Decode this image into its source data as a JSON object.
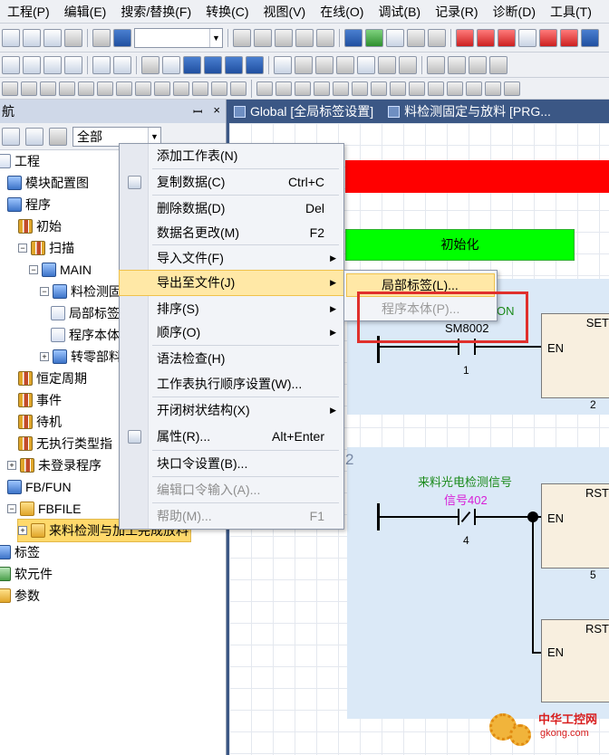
{
  "menubar": [
    "工程(P)",
    "编辑(E)",
    "搜索/替换(F)",
    "转换(C)",
    "视图(V)",
    "在线(O)",
    "调试(B)",
    "记录(R)",
    "诊断(D)",
    "工具(T)"
  ],
  "nav": {
    "title": "航",
    "pin": "ꟷ",
    "close": "×",
    "filter_value": "全部",
    "tree": [
      {
        "label": "工程",
        "indent": 0,
        "icon": "doc",
        "exp": ""
      },
      {
        "label": "模块配置图",
        "indent": 1,
        "icon": "prog",
        "exp": ""
      },
      {
        "label": "程序",
        "indent": 1,
        "icon": "prog",
        "exp": ""
      },
      {
        "label": "初始",
        "indent": 2,
        "icon": "bar",
        "exp": ""
      },
      {
        "label": "扫描",
        "indent": 2,
        "icon": "bar",
        "exp": "−"
      },
      {
        "label": "MAIN",
        "indent": 3,
        "icon": "prog",
        "exp": "−"
      },
      {
        "label": "料检测固定",
        "indent": 4,
        "icon": "prog",
        "exp": "−"
      },
      {
        "label": "局部标签",
        "indent": 5,
        "icon": "doc",
        "exp": ""
      },
      {
        "label": "程序本体",
        "indent": 5,
        "icon": "doc",
        "exp": ""
      },
      {
        "label": "转零部料",
        "indent": 4,
        "icon": "prog",
        "exp": "+"
      },
      {
        "label": "恒定周期",
        "indent": 2,
        "icon": "bar",
        "exp": ""
      },
      {
        "label": "事件",
        "indent": 2,
        "icon": "bar",
        "exp": ""
      },
      {
        "label": "待机",
        "indent": 2,
        "icon": "bar",
        "exp": ""
      },
      {
        "label": "无执行类型指",
        "indent": 2,
        "icon": "bar",
        "exp": ""
      },
      {
        "label": "未登录程序",
        "indent": 1,
        "icon": "bar",
        "exp": "+"
      },
      {
        "label": "FB/FUN",
        "indent": 1,
        "icon": "prog",
        "exp": ""
      },
      {
        "label": "FBFILE",
        "indent": 1,
        "icon": "folder",
        "exp": "−"
      },
      {
        "label": "来料检测与加工完成放料",
        "indent": 2,
        "icon": "folder",
        "exp": "+",
        "selected": true
      },
      {
        "label": "标签",
        "indent": 0,
        "icon": "prog",
        "exp": ""
      },
      {
        "label": "软元件",
        "indent": 0,
        "icon": "dev",
        "exp": ""
      },
      {
        "label": "参数",
        "indent": 0,
        "icon": "folder",
        "exp": ""
      }
    ]
  },
  "tabs": [
    {
      "label": "Global [全局标签设置]"
    },
    {
      "label": "料检测固定与放料 [PRG..."
    }
  ],
  "ladder": {
    "green_label": "初始化",
    "contact1_device": "SM8002",
    "contact1_step": "1",
    "coil1_label": "SET",
    "coil1_en": "EN",
    "coil1_step": "2",
    "partial_label": "ON",
    "section_mark": "2",
    "comment_line1": "来料光电检测信号",
    "comment_line2": "信号402",
    "contact2_step": "4",
    "coil2_label": "RST",
    "coil2_en": "EN",
    "coil2_step": "5",
    "coil3_label": "RST",
    "coil3_en": "EN"
  },
  "context_menu": [
    {
      "label": "添加工作表(N)",
      "shortcut": "",
      "submenu": false,
      "disabled": false
    },
    {
      "label": "复制数据(C)",
      "shortcut": "Ctrl+C",
      "submenu": false,
      "disabled": false,
      "icon": true
    },
    {
      "label": "删除数据(D)",
      "shortcut": "Del",
      "submenu": false,
      "disabled": false
    },
    {
      "label": "数据名更改(M)",
      "shortcut": "F2",
      "submenu": false,
      "disabled": false
    },
    {
      "label": "导入文件(F)",
      "shortcut": "",
      "submenu": true,
      "disabled": false
    },
    {
      "label": "导出至文件(J)",
      "shortcut": "",
      "submenu": true,
      "disabled": false,
      "highlight": true
    },
    {
      "label": "排序(S)",
      "shortcut": "",
      "submenu": true,
      "disabled": false
    },
    {
      "label": "顺序(O)",
      "shortcut": "",
      "submenu": true,
      "disabled": false
    },
    {
      "label": "语法检查(H)",
      "shortcut": "",
      "submenu": false,
      "disabled": false
    },
    {
      "label": "工作表执行顺序设置(W)...",
      "shortcut": "",
      "submenu": false,
      "disabled": false
    },
    {
      "label": "开闭树状结构(X)",
      "shortcut": "",
      "submenu": true,
      "disabled": false
    },
    {
      "label": "属性(R)...",
      "shortcut": "Alt+Enter",
      "submenu": false,
      "disabled": false,
      "icon": true
    },
    {
      "label": "块口令设置(B)...",
      "shortcut": "",
      "submenu": false,
      "disabled": false
    },
    {
      "label": "编辑口令输入(A)...",
      "shortcut": "",
      "submenu": false,
      "disabled": true
    },
    {
      "label": "帮助(M)...",
      "shortcut": "F1",
      "submenu": false,
      "disabled": true
    }
  ],
  "submenu": [
    {
      "label": "局部标签(L)...",
      "disabled": false
    },
    {
      "label": "程序本体(P)...",
      "disabled": true
    }
  ],
  "watermark": {
    "line1": "中华工控网",
    "line2": "gkong.com"
  },
  "colors": {
    "accent": "#3b5785",
    "highlight": "#ffe8a6",
    "annotation": "#e0302c"
  }
}
